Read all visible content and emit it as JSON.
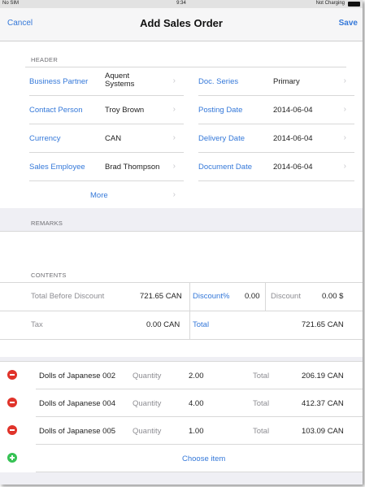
{
  "status_bar": {
    "carrier": "No SIM",
    "time": "9:34",
    "battery_text": "Not Charging"
  },
  "nav": {
    "cancel_label": "Cancel",
    "title": "Add Sales Order",
    "save_label": "Save"
  },
  "header": {
    "section_label": "HEADER",
    "left_rows": [
      {
        "label": "Business Partner",
        "value": "Aquent Systems"
      },
      {
        "label": "Contact Person",
        "value": "Troy Brown"
      },
      {
        "label": "Currency",
        "value": "CAN"
      },
      {
        "label": "Sales Employee",
        "value": "Brad Thompson"
      }
    ],
    "right_rows": [
      {
        "label": "Doc. Series",
        "value": "Primary"
      },
      {
        "label": "Posting Date",
        "value": "2014-06-04"
      },
      {
        "label": "Delivery Date",
        "value": "2014-06-04"
      },
      {
        "label": "Document Date",
        "value": "2014-06-04"
      }
    ],
    "more_label": "More",
    "chevron": "›"
  },
  "remarks": {
    "section_label": "REMARKS",
    "value": ""
  },
  "contents": {
    "section_label": "CONTENTS",
    "total_before_discount_label": "Total Before Discount",
    "total_before_discount_value": "721.65 CAN",
    "discount_pct_label": "Discount%",
    "discount_pct_value": "0.00",
    "discount_label": "Discount",
    "discount_value": "0.00 $",
    "tax_label": "Tax",
    "tax_value": "0.00 CAN",
    "total_label": "Total",
    "total_value": "721.65 CAN"
  },
  "items": [
    {
      "name": "Dolls of Japanese 002",
      "qty_label": "Quantity",
      "qty": "2.00",
      "total_label": "Total",
      "total": "206.19 CAN"
    },
    {
      "name": "Dolls of Japanese 004",
      "qty_label": "Quantity",
      "qty": "4.00",
      "total_label": "Total",
      "total": "412.37 CAN"
    },
    {
      "name": "Dolls of Japanese 005",
      "qty_label": "Quantity",
      "qty": "1.00",
      "total_label": "Total",
      "total": "103.09 CAN"
    }
  ],
  "choose_item_label": "Choose item",
  "colors": {
    "accent": "#3478d9",
    "remove": "#e0332a",
    "add": "#36c254",
    "background": "#efeff4"
  },
  "icons": {
    "remove": "remove-circle-icon",
    "add": "add-circle-icon",
    "disclosure": "chevron-right-icon"
  }
}
